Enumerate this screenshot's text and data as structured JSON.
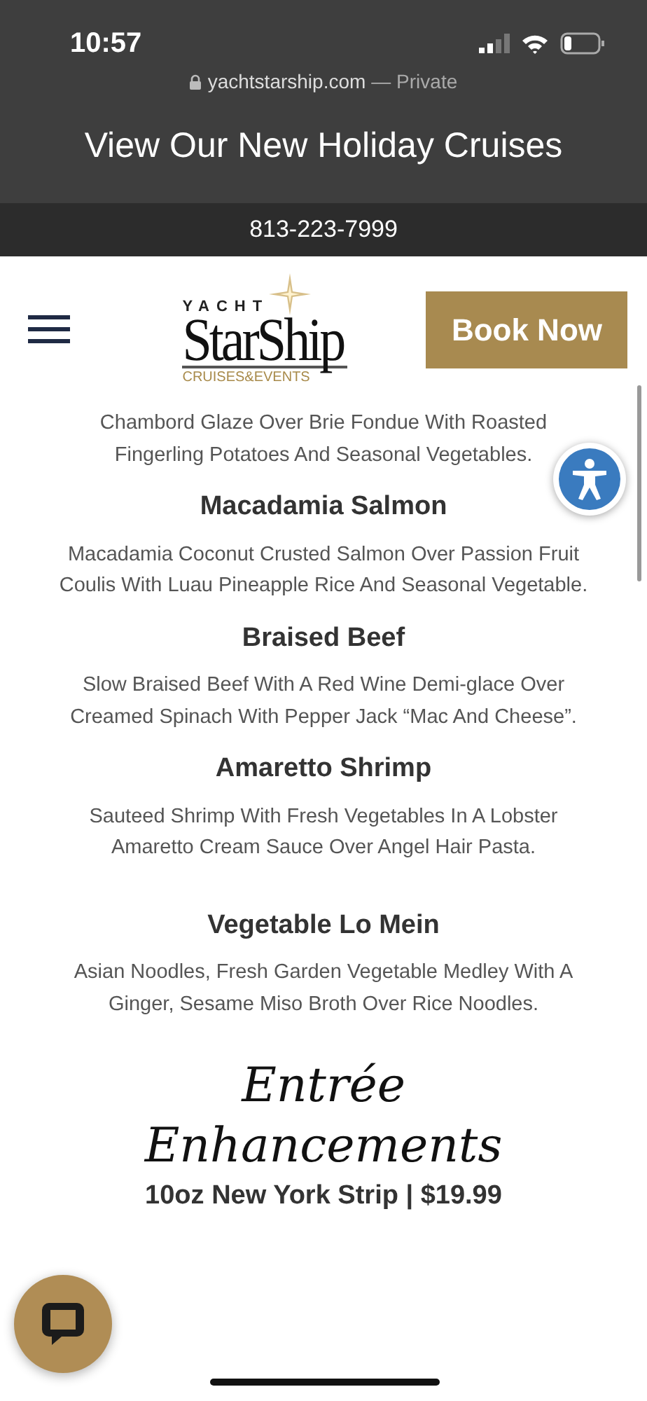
{
  "status_bar": {
    "time": "10:57"
  },
  "browser": {
    "url": "yachtstarship.com",
    "mode": "— Private"
  },
  "banner": {
    "title": "View Our New Holiday Cruises"
  },
  "phone_bar": {
    "phone": "813-223-7999"
  },
  "header": {
    "logo": {
      "top": "YACHT",
      "name": "StarShip",
      "tagline": "CRUISES&EVENTS"
    },
    "book_button": "Book Now"
  },
  "menu": {
    "dishes": [
      {
        "description": "Chambord Glaze Over Brie Fondue With Roasted Fingerling Potatoes And Seasonal Vegetables."
      },
      {
        "name": "Macadamia Salmon",
        "description": "Macadamia Coconut Crusted Salmon Over Passion Fruit Coulis With Luau Pineapple Rice And Seasonal Vegetable."
      },
      {
        "name": "Braised Beef",
        "description": "Slow Braised Beef With A Red Wine Demi-glace Over Creamed Spinach With Pepper Jack “Mac And Cheese”."
      },
      {
        "name": "Amaretto Shrimp",
        "description": "Sauteed Shrimp With Fresh Vegetables In A Lobster Amaretto Cream Sauce Over Angel Hair Pasta."
      },
      {
        "name": "Vegetable Lo Mein",
        "description": "Asian Noodles, Fresh Garden Vegetable Medley With A Ginger, Sesame Miso Broth Over Rice Noodles."
      }
    ],
    "section": {
      "title_lines": [
        "Entrée",
        "Enhancements"
      ],
      "items": [
        "10oz New York Strip | $19.99"
      ]
    }
  }
}
